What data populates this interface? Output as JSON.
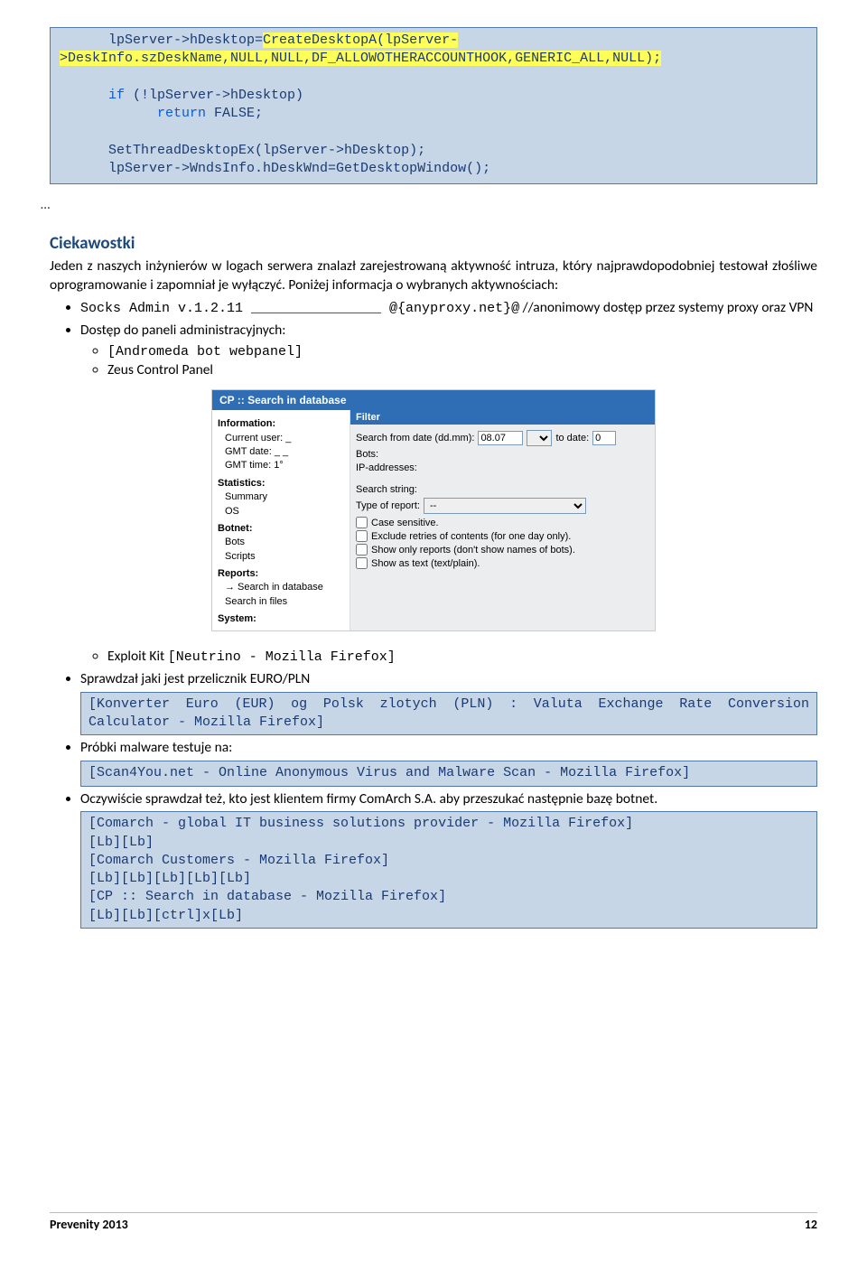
{
  "code1": {
    "l1a": "      lpServer->hDesktop=",
    "l1b": "CreateDesktopA(lpServer-\n>DeskInfo.szDeskName,NULL,NULL,DF_ALLOWOTHERACCOUNTHOOK,GENERIC_ALL,NULL);",
    "l2a": "      ",
    "l2b": "if",
    "l2c": " (!lpServer->hDesktop)",
    "l3a": "            ",
    "l3b": "return",
    "l3c": " FALSE;",
    "l4": "      SetThreadDesktopEx(lpServer->hDesktop);",
    "l5": "      lpServer->WndsInfo.hDeskWnd=GetDesktopWindow();",
    "ell": "…"
  },
  "section_title": "Ciekawostki",
  "para1": "Jeden z naszych inżynierów w logach serwera znalazł zarejestrowaną aktywność intruza, który najprawdopodobniej testował złośliwe oprogramowanie i zapomniał je wyłączyć. Poniżej informacja o wybranych aktywnościach:",
  "b1": {
    "code": "Socks Admin v.1.2.11 ________________ @{anyproxy.net}@",
    "tail": " //anonimowy dostęp przez systemy proxy oraz VPN"
  },
  "b2": "Dostęp do paneli administracyjnych:",
  "b2s1": "[Andromeda bot webpanel]",
  "b2s2": "Zeus Control Panel",
  "cp": {
    "title": "CP :: Search in database",
    "left": {
      "info": "Information:",
      "cu": "Current user: _",
      "gd": "GMT date: _ _",
      "gt": "GMT time: 1°",
      "stats": "Statistics:",
      "sum": "Summary",
      "os": "OS",
      "botnet": "Botnet:",
      "bots": "Bots",
      "scripts": "Scripts",
      "reports": "Reports:",
      "sdb": "→ Search in database",
      "sf": "Search in files",
      "system": "System:"
    },
    "right": {
      "filter": "Filter",
      "sfd": "Search from date (dd.mm):",
      "d1": "08.07",
      "td": "to date:",
      "d2": "0",
      "bots": "Bots:",
      "ip": "IP-addresses:",
      "ss": "Search string:",
      "tor": "Type of report:",
      "torv": "--",
      "c1": "Case sensitive.",
      "c2": "Exclude retries of contents (for one day only).",
      "c3": "Show only reports (don't show names of bots).",
      "c4": "Show as text (text/plain)."
    }
  },
  "b2s3a": "Exploit Kit ",
  "b2s3b": "[Neutrino - Mozilla Firefox]",
  "b3": "Sprawdzał jaki jest przelicznik EURO/PLN",
  "box3": "[Konverter Euro (EUR) og Polsk zlotych (PLN) : Valuta Exchange Rate Conversion Calculator - Mozilla Firefox]",
  "b4": "Próbki malware testuje na:",
  "box4": "[Scan4You.net - Online Anonymous Virus and Malware Scan - Mozilla Firefox]",
  "b5": "Oczywiście sprawdzał też, kto jest klientem firmy ComArch S.A. aby przeszukać następnie bazę botnet.",
  "box5": "[Comarch - global IT business solutions provider - Mozilla Firefox]\n[Lb][Lb]\n[Comarch Customers - Mozilla Firefox]\n[Lb][Lb][Lb][Lb][Lb]\n[CP :: Search in database - Mozilla Firefox]\n[Lb][Lb][ctrl]x[Lb]",
  "footer_left": "Prevenity 2013",
  "footer_right": "12"
}
